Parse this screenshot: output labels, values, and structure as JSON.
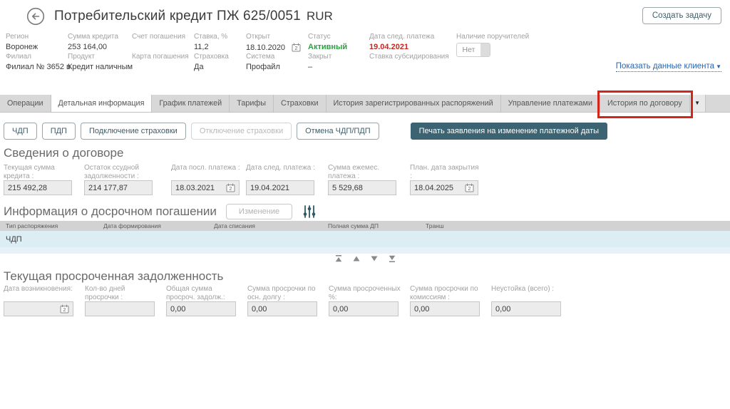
{
  "colors": {
    "accent_teal": "#3b6372",
    "status_green": "#2f9e44",
    "alert_red": "#c9271e",
    "link_blue": "#2b66b0",
    "highlight_red": "#d0261b",
    "row_blue": "#dcedf4"
  },
  "header": {
    "back_icon": "arrow-left-circle",
    "title": "Потребительский кредит ПЖ 625/0051",
    "currency": "RUR",
    "create_task_button": "Создать задачу",
    "show_client_data_link": "Показать данные клиента",
    "show_client_caret": "▼",
    "info_row1": [
      {
        "label": "Регион",
        "value": "Воронеж"
      },
      {
        "label": "Сумма кредита",
        "value": "253 164,00"
      },
      {
        "label": "Счет погашения",
        "value": ""
      },
      {
        "label": "Ставка, %",
        "value": "11,2"
      },
      {
        "label": "Открыт",
        "value": "18.10.2020",
        "calendar_icon": "calendar-icon"
      },
      {
        "label": "Статус",
        "value": "Активный",
        "color": "green"
      },
      {
        "label": "Дата след. платежа",
        "value": "19.04.2021",
        "color": "red"
      },
      {
        "label": "Наличие поручителей",
        "value": "Нет",
        "control": "toggle"
      }
    ],
    "info_row2": [
      {
        "label": "Филиал",
        "value": "Филиал № 3652 в"
      },
      {
        "label": "Продукт",
        "value": "Кредит наличным"
      },
      {
        "label": "Карта погашения",
        "value": ""
      },
      {
        "label": "Страховка",
        "value": "Да"
      },
      {
        "label": "Система",
        "value": "Профайл"
      },
      {
        "label": "Закрыт",
        "value": "–"
      },
      {
        "label": "Ставка субсидирования",
        "value": ""
      }
    ]
  },
  "tabs": {
    "items": [
      "Операции",
      "Детальная информация",
      "График платежей",
      "Тарифы",
      "Страховки",
      "История зарегистрированных распоряжений",
      "Управление платежами",
      "История по договору"
    ],
    "active_index": 1,
    "highlighted_index": 7,
    "overflow_arrow": "▼"
  },
  "action_buttons": {
    "chdp": "ЧДП",
    "pdp": "ПДП",
    "connect_insurance": "Подключение страховки",
    "disconnect_insurance": "Отключение страховки",
    "cancel_chdp_pdp": "Отмена ЧДП/ПДП",
    "print_statement": "Печать заявления на изменение платежной даты"
  },
  "contract_details": {
    "title": "Сведения о договоре",
    "fields": [
      {
        "label": "Текущая сумма кредита :",
        "value": "215 492,28"
      },
      {
        "label": "Остаток ссудной задолженности :",
        "value": "214 177,87"
      },
      {
        "label": "Дата посл. платежа :",
        "value": "18.03.2021",
        "calendar_icon": "calendar-icon"
      },
      {
        "label": "Дата след. платежа :",
        "value": "19.04.2021"
      },
      {
        "label": "Сумма ежемес. платежа :",
        "value": "5 529,68"
      },
      {
        "label": "План. дата закрытия :",
        "value": "18.04.2025",
        "calendar_icon": "calendar-icon"
      }
    ]
  },
  "early_repayment": {
    "title": "Информация о досрочном погашении",
    "change_button": "Изменение",
    "filter_icon": "sliders-icon",
    "table": {
      "headers": [
        "Тип распоряжения",
        "Дата формирования",
        "Дата списания",
        "Полная сумма ДП",
        "Транш"
      ],
      "rows": [
        {
          "order_type": "ЧДП"
        }
      ]
    },
    "pager_icons": [
      "go-first-icon",
      "up-icon",
      "down-icon",
      "go-last-icon"
    ]
  },
  "overdue_debt": {
    "title": "Текущая просроченная задолженность",
    "fields": [
      {
        "label": "Дата возникновения:",
        "value": "",
        "calendar_icon": "calendar-icon"
      },
      {
        "label": "Кол-во дней просрочки :",
        "value": ""
      },
      {
        "label": "Общая сумма просроч. задолж.:",
        "value": "0,00"
      },
      {
        "label": "Сумма просрочки по осн. долгу :",
        "value": "0,00"
      },
      {
        "label": "Сумма просроченных %:",
        "value": "0,00"
      },
      {
        "label": "Сумма просрочки по комиссиям :",
        "value": "0,00"
      },
      {
        "label": "Неустойка (всего) :",
        "value": "0,00"
      }
    ]
  }
}
